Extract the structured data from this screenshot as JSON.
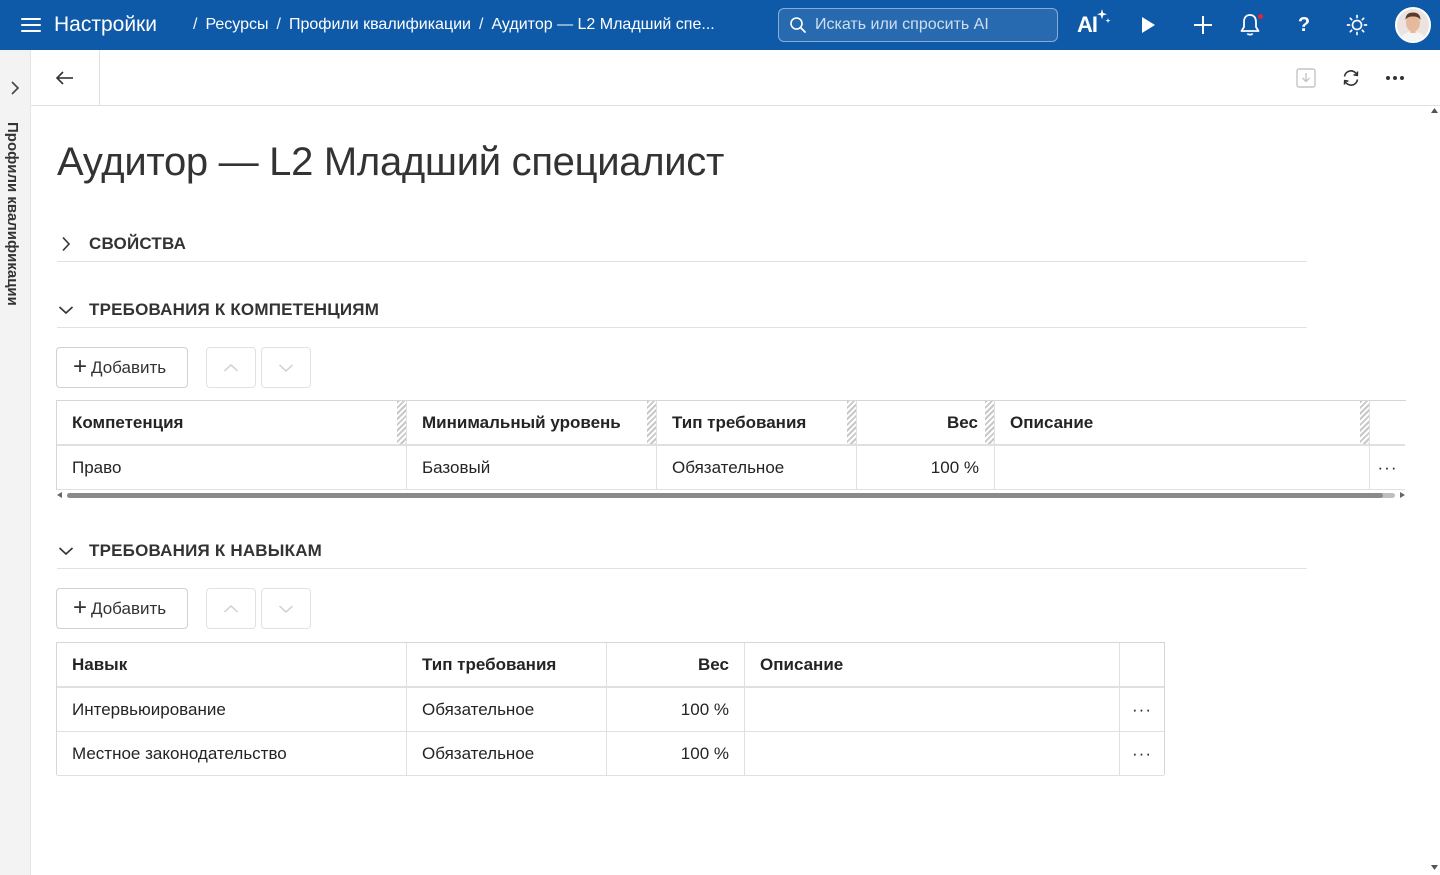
{
  "topbar": {
    "app_title": "Настройки",
    "breadcrumbs": [
      "Ресурсы",
      "Профили квалификации",
      "Аудитор — L2 Младший спе..."
    ],
    "breadcrumb_sep": "/",
    "search_placeholder": "Искать или спросить AI",
    "ai_label": "AI",
    "help_label": "?",
    "icons": [
      "menu-icon",
      "search-icon",
      "ai-sparkle-icon",
      "play-icon",
      "plus-icon",
      "bell-icon",
      "help-icon",
      "sun-icon"
    ],
    "accent_color": "#0f5aa8",
    "notification_dot_color": "#e3223c"
  },
  "rail": {
    "label": "Профили квалификации"
  },
  "page": {
    "title": "Аудитор — L2 Младший специалист"
  },
  "sections": {
    "properties": {
      "title": "СВОЙСТВА",
      "expanded": false
    },
    "competencies": {
      "title": "ТРЕБОВАНИЯ К КОМПЕТЕНЦИЯМ",
      "expanded": true,
      "add_label": "Добавить",
      "columns": [
        "Компетенция",
        "Минимальный уровень",
        "Тип требования",
        "Вес",
        "Описание"
      ],
      "rows": [
        {
          "competency": "Право",
          "min_level": "Базовый",
          "req_type": "Обязательное",
          "weight": "100 %",
          "description": "",
          "menu": "···"
        }
      ]
    },
    "skills": {
      "title": "ТРЕБОВАНИЯ К НАВЫКАМ",
      "expanded": true,
      "add_label": "Добавить",
      "columns": [
        "Навык",
        "Тип требования",
        "Вес",
        "Описание"
      ],
      "rows": [
        {
          "skill": "Интервьюирование",
          "req_type": "Обязательное",
          "weight": "100 %",
          "description": "",
          "menu": "···"
        },
        {
          "skill": "Местное законодательство",
          "req_type": "Обязательное",
          "weight": "100 %",
          "description": "",
          "menu": "···"
        }
      ]
    }
  }
}
